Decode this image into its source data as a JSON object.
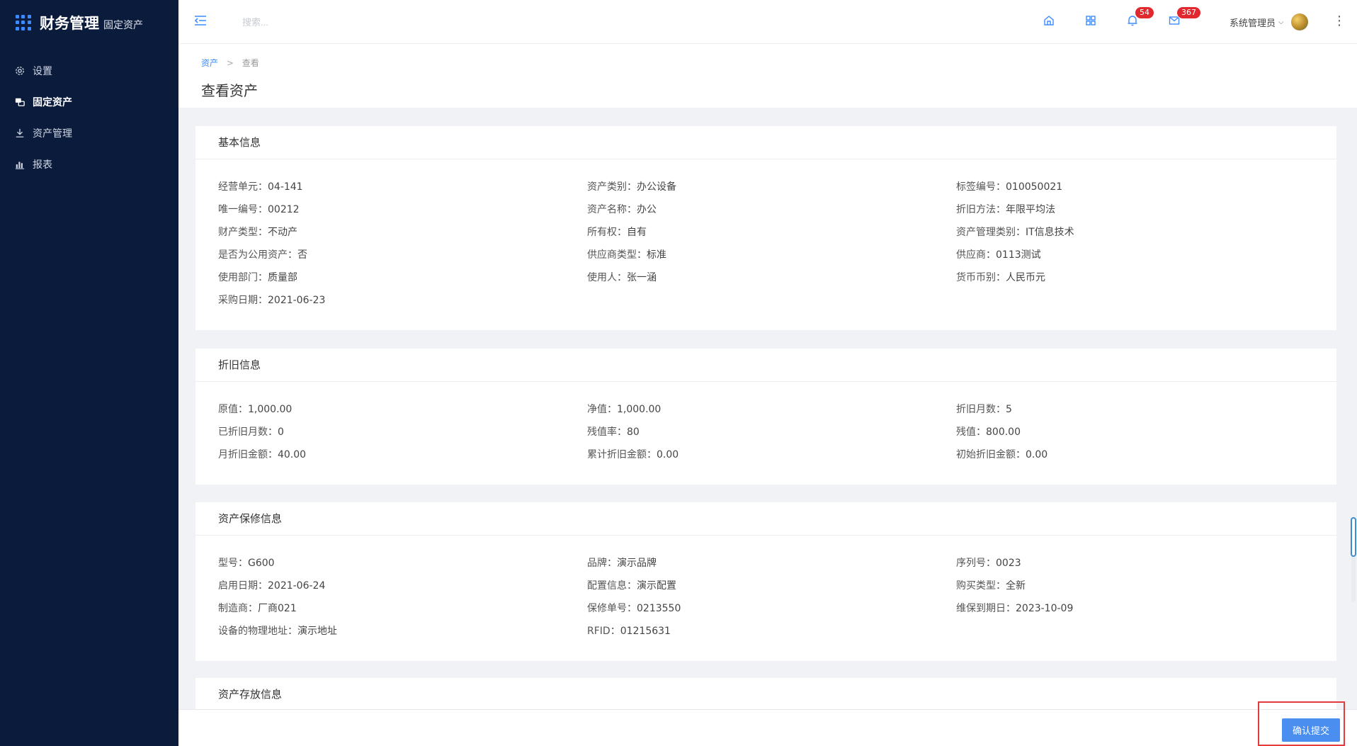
{
  "app": {
    "title": "财务管理",
    "subtitle": "固定资产"
  },
  "sidebar": {
    "items": [
      {
        "label": "设置",
        "icon": "gear-icon"
      },
      {
        "label": "固定资产",
        "icon": "asset-icon",
        "active": true
      },
      {
        "label": "资产管理",
        "icon": "manage-icon"
      },
      {
        "label": "报表",
        "icon": "chart-icon"
      }
    ]
  },
  "header": {
    "search_placeholder": "搜索...",
    "notifications_count": "54",
    "messages_count": "367",
    "user_name": "系统管理员",
    "user_chevron": "⌵",
    "more_glyph": "⋮"
  },
  "breadcrumb": {
    "root": "资产",
    "separator": ">",
    "current": "查看"
  },
  "page": {
    "title": "查看资产"
  },
  "sections": {
    "basic": {
      "title": "基本信息",
      "rows": [
        [
          {
            "label": "经营单元：",
            "value": "04-141"
          },
          {
            "label": "资产类别：",
            "value": "办公设备"
          },
          {
            "label": "标签编号：",
            "value": "010050021"
          }
        ],
        [
          {
            "label": "唯一编号：",
            "value": "00212"
          },
          {
            "label": "资产名称：",
            "value": "办公"
          },
          {
            "label": "折旧方法：",
            "value": "年限平均法"
          }
        ],
        [
          {
            "label": "财产类型：",
            "value": "不动产"
          },
          {
            "label": "所有权：",
            "value": "自有"
          },
          {
            "label": "资产管理类别：",
            "value": "IT信息技术"
          }
        ],
        [
          {
            "label": "是否为公用资产：",
            "value": "否"
          },
          {
            "label": "供应商类型：",
            "value": "标准"
          },
          {
            "label": "供应商：",
            "value": "0113测试"
          }
        ],
        [
          {
            "label": "使用部门：",
            "value": "质量部"
          },
          {
            "label": "使用人：",
            "value": "张一涵"
          },
          {
            "label": "货币币别：",
            "value": "人民币元"
          }
        ],
        [
          {
            "label": "采购日期：",
            "value": "2021-06-23"
          }
        ]
      ]
    },
    "depreciation": {
      "title": "折旧信息",
      "rows": [
        [
          {
            "label": "原值：",
            "value": "1,000.00"
          },
          {
            "label": "净值：",
            "value": "1,000.00"
          },
          {
            "label": "折旧月数：",
            "value": "5"
          }
        ],
        [
          {
            "label": "已折旧月数：",
            "value": "0"
          },
          {
            "label": "残值率：",
            "value": "80"
          },
          {
            "label": "残值：",
            "value": "800.00"
          }
        ],
        [
          {
            "label": "月折旧金额：",
            "value": "40.00"
          },
          {
            "label": "累计折旧金额：",
            "value": "0.00"
          },
          {
            "label": "初始折旧金额：",
            "value": "0.00"
          }
        ]
      ]
    },
    "warranty": {
      "title": "资产保修信息",
      "rows": [
        [
          {
            "label": "型号：",
            "value": "G600"
          },
          {
            "label": "品牌：",
            "value": "演示品牌"
          },
          {
            "label": "序列号：",
            "value": "0023"
          }
        ],
        [
          {
            "label": "启用日期：",
            "value": "2021-06-24"
          },
          {
            "label": "配置信息：",
            "value": "演示配置"
          },
          {
            "label": "购买类型：",
            "value": "全新"
          }
        ],
        [
          {
            "label": "制造商：",
            "value": "厂商021"
          },
          {
            "label": "保修单号：",
            "value": "0213550"
          },
          {
            "label": "维保到期日：",
            "value": "2023-10-09"
          }
        ],
        [
          {
            "label": "设备的物理地址：",
            "value": "演示地址"
          },
          {
            "label": "RFID：",
            "value": "01215631"
          }
        ]
      ]
    },
    "storage": {
      "title": "资产存放信息"
    }
  },
  "footer": {
    "confirm_label": "确认提交"
  },
  "colors": {
    "sidebar_bg": "#0b1b3b",
    "accent": "#3d8bff",
    "badge": "#e0282e",
    "button": "#4a8ef0",
    "highlight": "#e23b3b"
  }
}
